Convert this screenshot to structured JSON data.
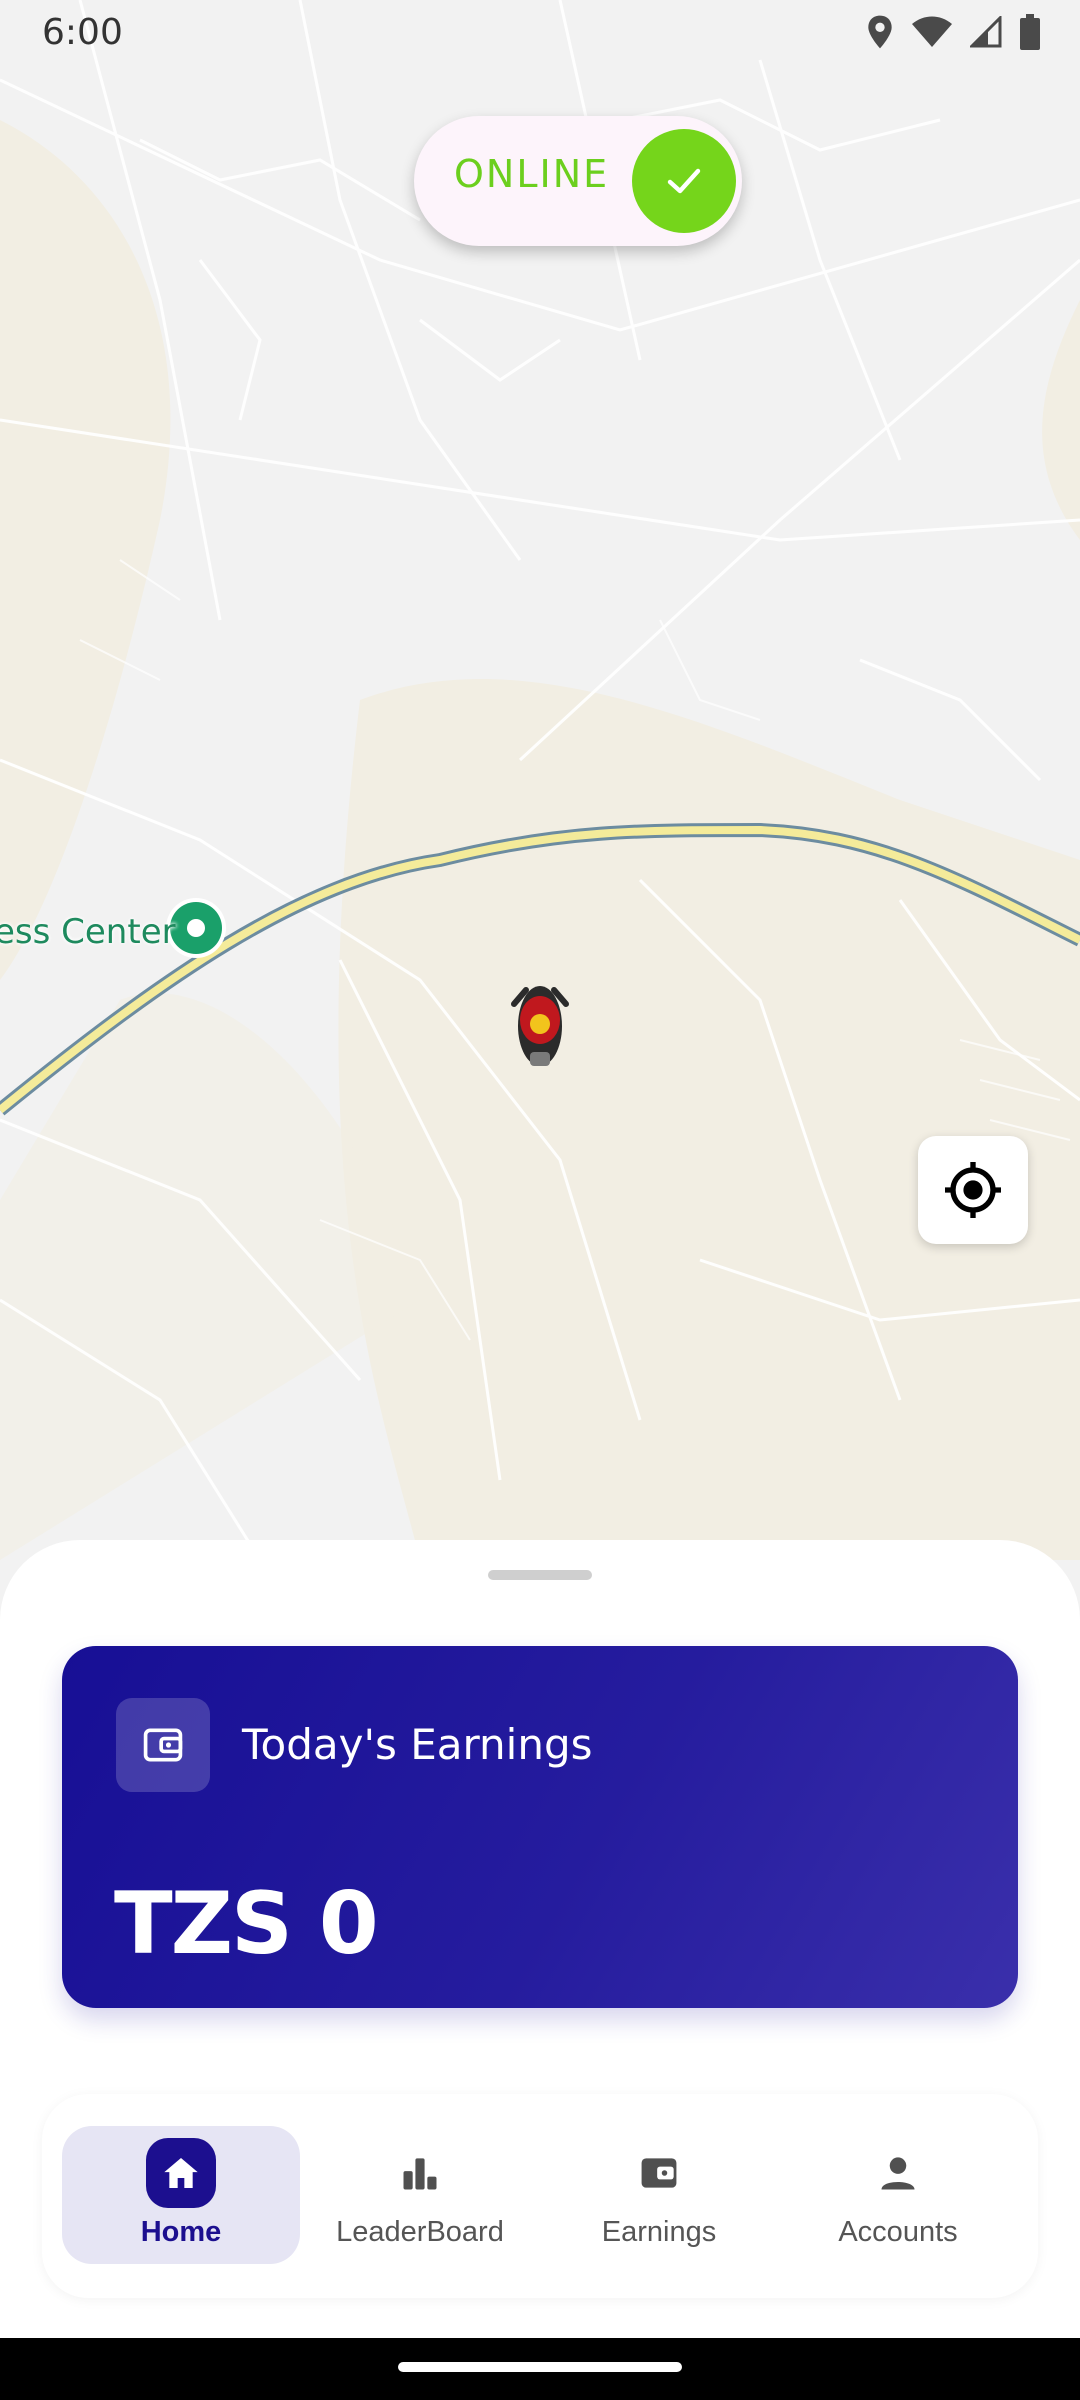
{
  "status_bar": {
    "time": "6:00",
    "icons": [
      "location-icon",
      "wifi-icon",
      "signal-icon",
      "battery-icon"
    ]
  },
  "online_toggle": {
    "label": "ONLINE",
    "state": true,
    "accent": "#75d51b"
  },
  "map": {
    "place_label": "ess Center",
    "marker_color": "#1aa06a",
    "rider_color": "#c0181e"
  },
  "earnings_card": {
    "title": "Today's Earnings",
    "amount": "TZS 0",
    "icon": "wallet-icon",
    "color": "#170f95"
  },
  "bottom_nav": {
    "items": [
      {
        "label": "Home",
        "icon": "home-icon",
        "active": true
      },
      {
        "label": "LeaderBoard",
        "icon": "bar-chart-icon",
        "active": false
      },
      {
        "label": "Earnings",
        "icon": "wallet-icon",
        "active": false
      },
      {
        "label": "Accounts",
        "icon": "person-icon",
        "active": false
      }
    ]
  }
}
